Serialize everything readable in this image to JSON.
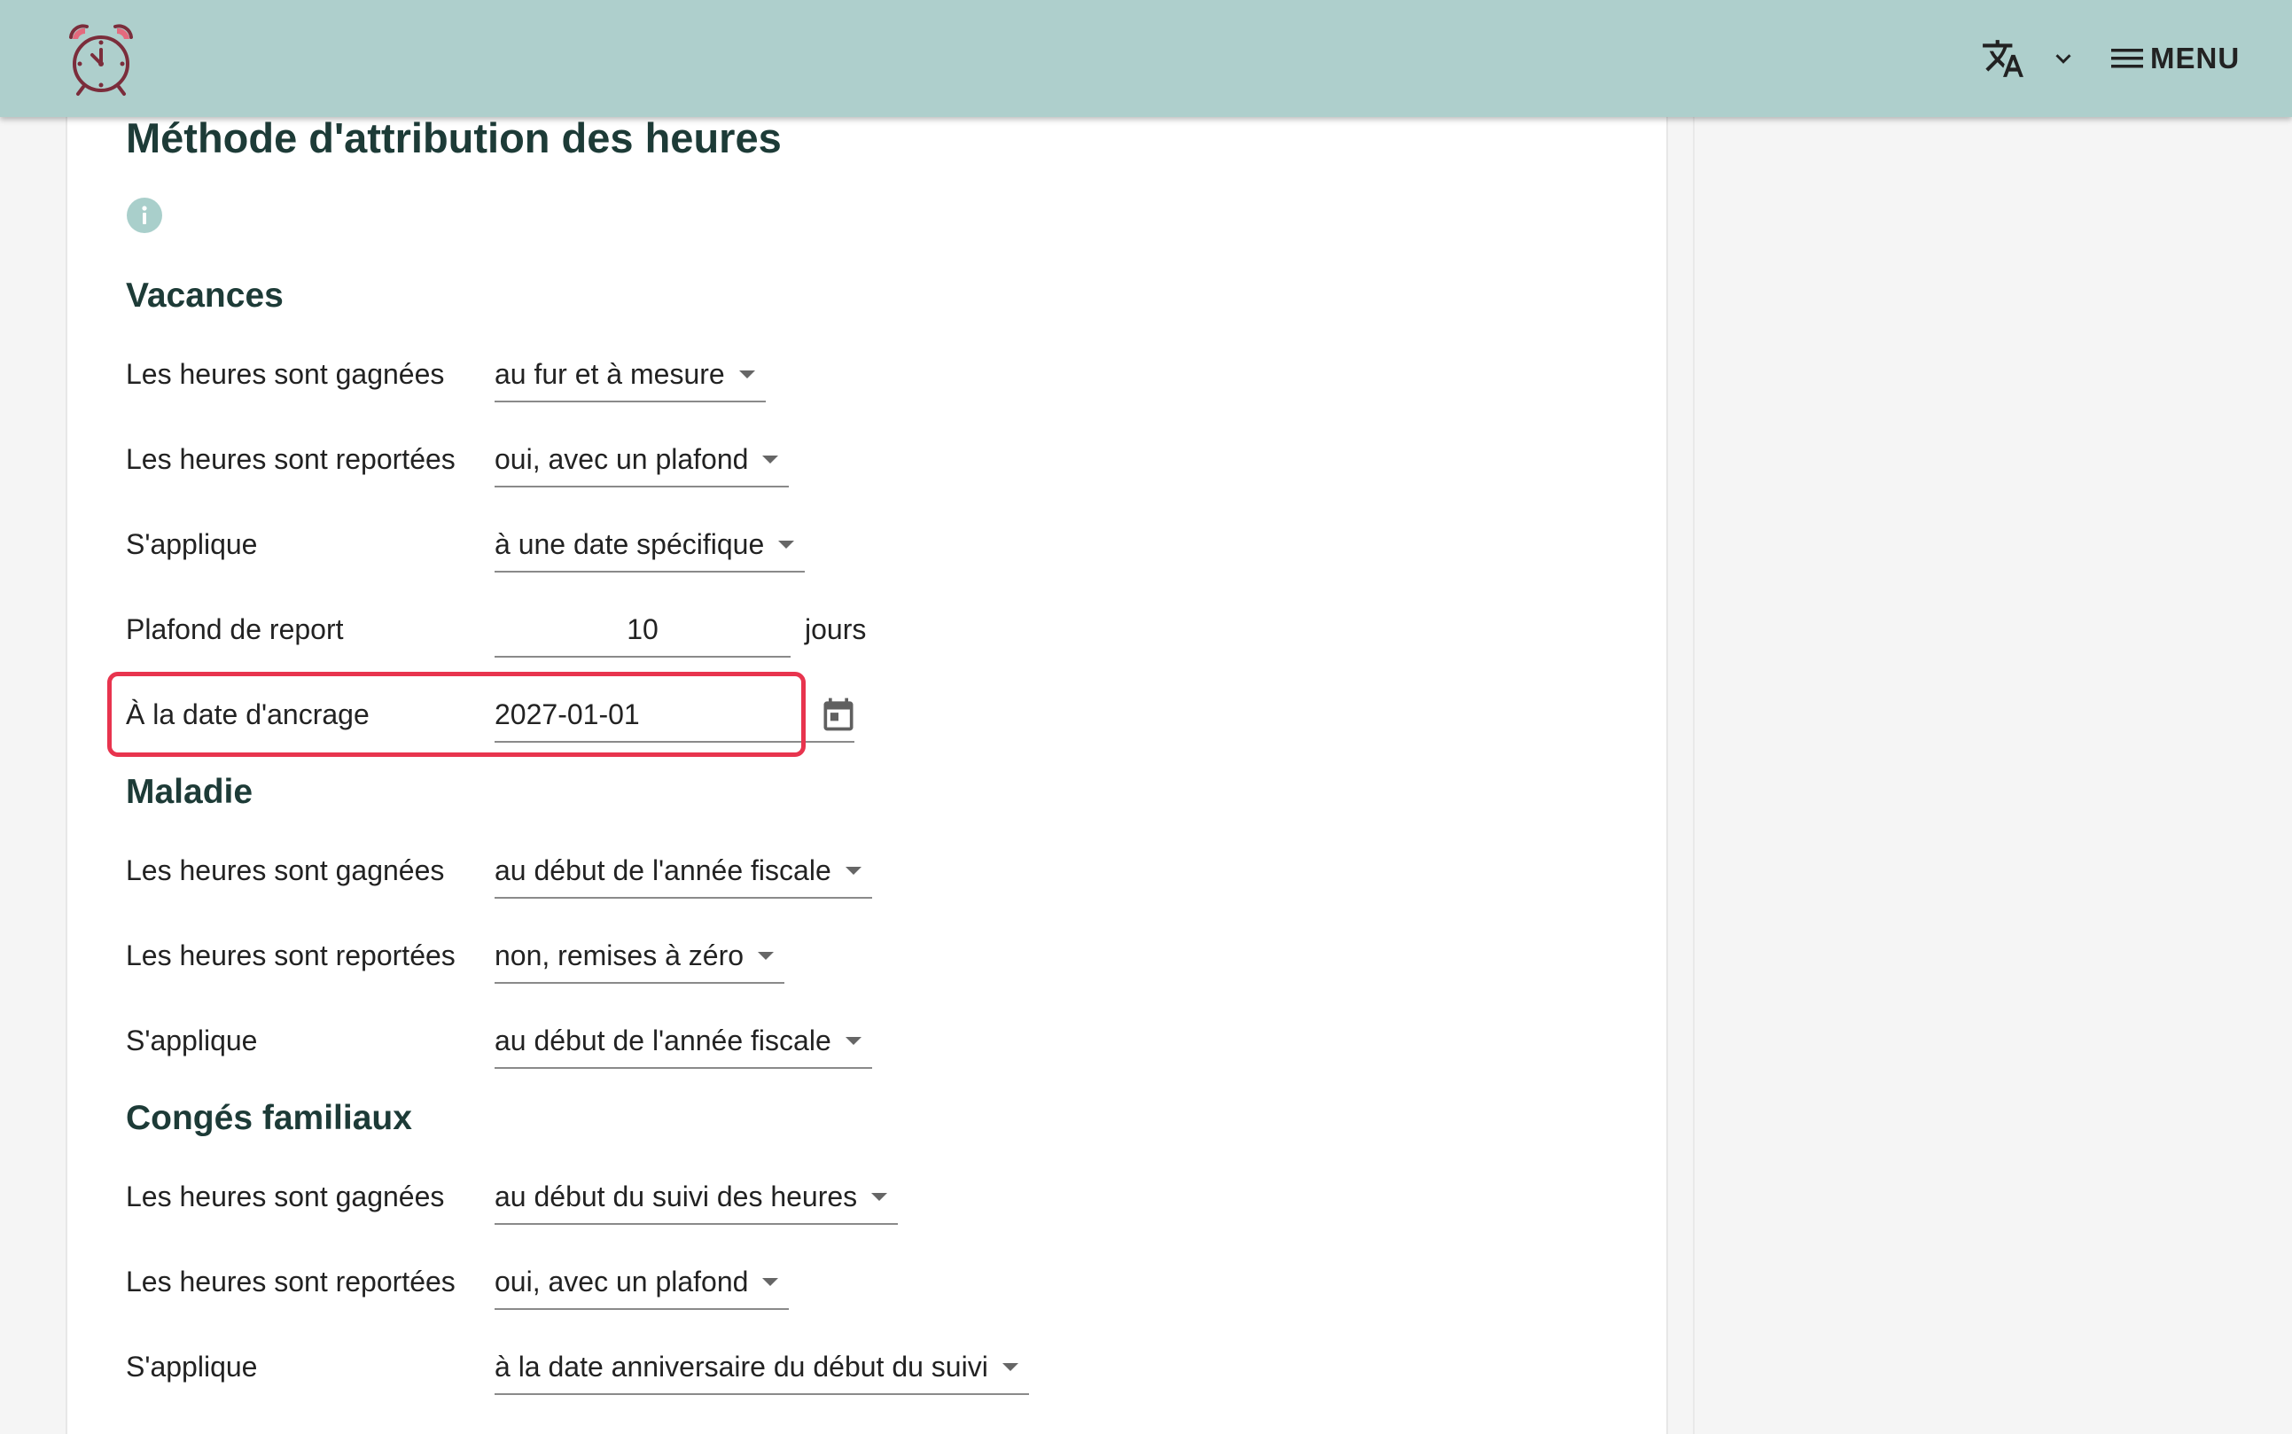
{
  "header": {
    "logo_icon": "alarm-clock-icon",
    "translate_icon": "translate-icon",
    "lang_dropdown_icon": "chevron-down-icon",
    "menu_label": "MENU",
    "menu_icon": "hamburger-icon",
    "bg_color": "#aecfcc"
  },
  "main": {
    "title": "Méthode d'attribution des heures",
    "info_icon": "info-icon",
    "info_icon_color": "#a9cfcb"
  },
  "vacances": {
    "title": "Vacances",
    "earned_label": "Les heures sont gagnées",
    "earned_value": "au fur et à mesure",
    "carried_label": "Les heures sont reportées",
    "carried_value": "oui, avec un plafond",
    "applies_label": "S'applique",
    "applies_value": "à une date spécifique",
    "cap_label": "Plafond de report",
    "cap_value": "10",
    "cap_unit": "jours",
    "anchor_label": "À la date d'ancrage",
    "anchor_value": "2027-01-01",
    "calendar_icon": "calendar-icon",
    "highlight_color": "#e8344e"
  },
  "maladie": {
    "title": "Maladie",
    "earned_label": "Les heures sont gagnées",
    "earned_value": "au début de l'année fiscale",
    "carried_label": "Les heures sont reportées",
    "carried_value": "non, remises à zéro",
    "applies_label": "S'applique",
    "applies_value": "au début de l'année fiscale"
  },
  "familiaux": {
    "title": "Congés familiaux",
    "earned_label": "Les heures sont gagnées",
    "earned_value": "au début du suivi des heures",
    "carried_label": "Les heures sont reportées",
    "carried_value": "oui, avec un plafond",
    "applies_label": "S'applique",
    "applies_value": "à la date anniversaire du début du suivi"
  }
}
